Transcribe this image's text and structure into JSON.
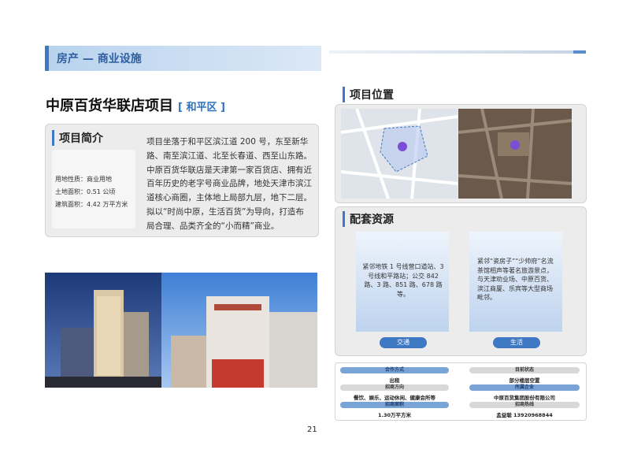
{
  "header": {
    "section_title": "房产 — 商业设施"
  },
  "project": {
    "name": "中原百货华联店项目",
    "district": "[ 和平区 ]"
  },
  "intro": {
    "heading": "项目简介",
    "facts": [
      {
        "label": "用地性质：",
        "value": "商业用地"
      },
      {
        "label": "土地面积：",
        "value": "0.51 公顷"
      },
      {
        "label": "建筑面积：",
        "value": "4.42 万平方米"
      }
    ],
    "description": "项目坐落于和平区滨江道 200 号，东至新华路、南至滨江道、北至长春道、西至山东路。中原百货华联店是天津第一家百货店、拥有近百年历史的老字号商业品牌，地处天津市滨江道核心商圈，主体地上局部九层，地下二层。拟以“时尚中原，生活百货”为导向，打造布局合理、品类齐全的“小而精”商业。"
  },
  "location": {
    "heading": "项目位置"
  },
  "resources": {
    "heading": "配套资源",
    "cards": [
      {
        "text": "紧邻地铁 1 号线营口道站、3 号线和平路站；公交 842 路、3 路、851 路、678 路等。",
        "button": "交通"
      },
      {
        "text": "紧邻“瓷房子”“少帅府”名流茶馆相声等著名旅游景点，与天津劝业场、中原百货、滨江商厦、乐宾等大型商场毗邻。",
        "button": "生活"
      }
    ]
  },
  "info": {
    "left": [
      {
        "label": "合作方式",
        "value": "出租"
      },
      {
        "label": "招商方向",
        "value": "餐饮、娱乐、运动休闲、健康会所等"
      },
      {
        "label": "招商面积",
        "value": "1.30万平方米"
      }
    ],
    "right": [
      {
        "label": "目前状态",
        "value": "部分楼层空置"
      },
      {
        "label": "所属企业",
        "value": "中原百货集团股份有限公司"
      },
      {
        "label": "招商热线",
        "value": "孟益聪  13920968844"
      }
    ]
  },
  "page_number": "21"
}
